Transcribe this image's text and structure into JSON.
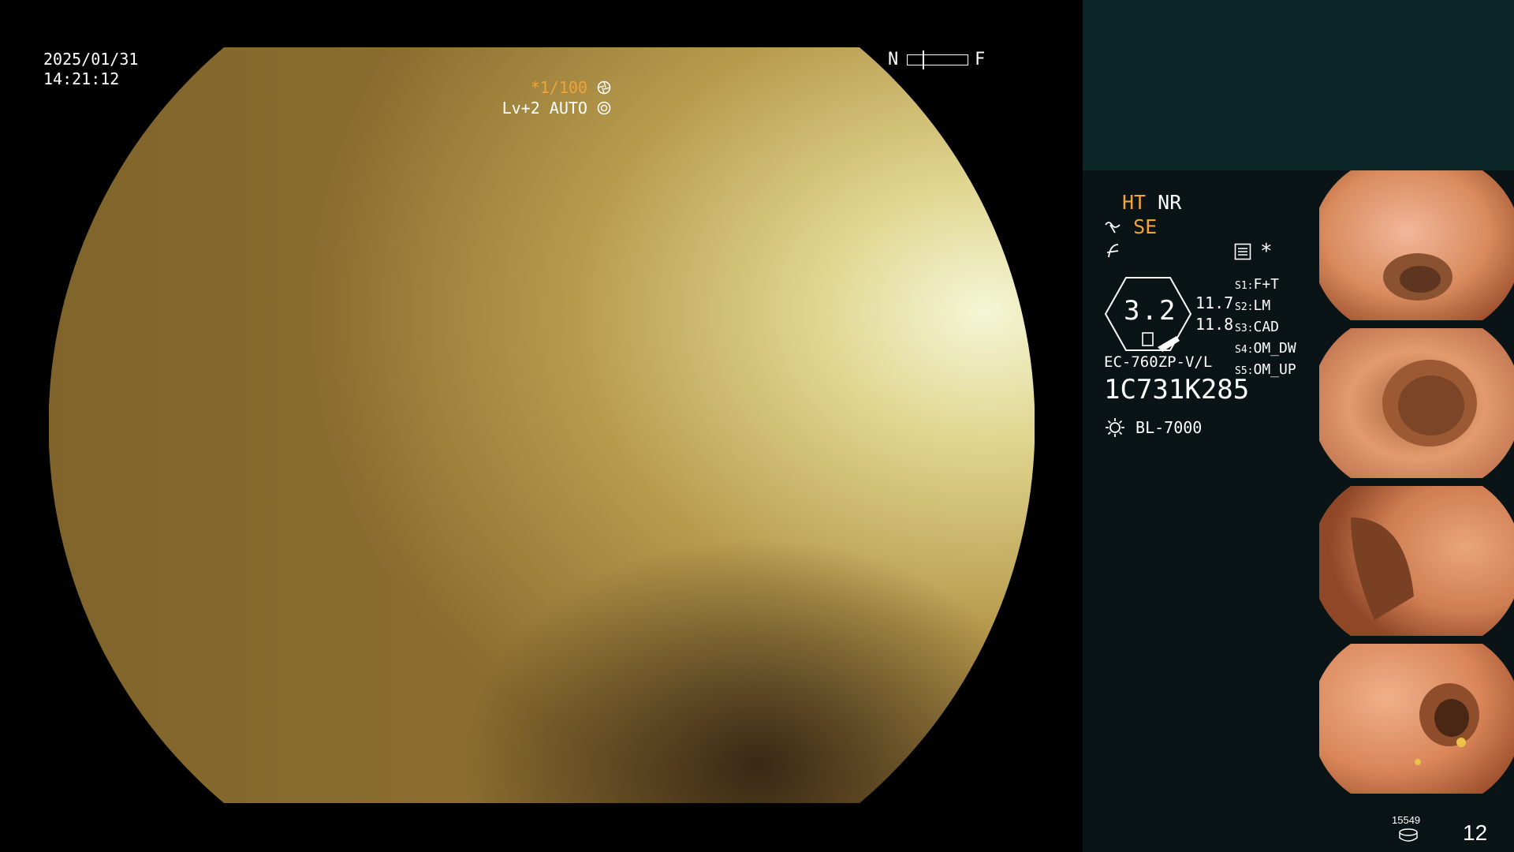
{
  "overlay": {
    "date": "2025/01/31",
    "time": "14:21:12",
    "nf_near": "N",
    "nf_far": "F",
    "shutter": "*1/100",
    "level": "Lv+2 AUTO"
  },
  "side": {
    "mode_ht": "HT",
    "mode_nr": "NR",
    "mode_se": "SE",
    "asterisk": "*",
    "gauge_value": "3.2",
    "gauge_v1": "11.7",
    "gauge_v2": "11.8",
    "scope_model": "EC-760ZP-V/L",
    "serial": "1C731K285",
    "light_source": "BL-7000",
    "s_keys": [
      "S1:",
      "S2:",
      "S3:",
      "S4:",
      "S5:"
    ],
    "s_values": [
      "F+T",
      "LM",
      "CAD",
      "OM_DW",
      "OM_UP"
    ],
    "frame_count": "15549",
    "thumb_count": "12"
  },
  "colors": {
    "accent": "#f2a33a",
    "panel_top": "#0b2627",
    "panel": "#0a1416"
  },
  "icons": {
    "shutter": "aperture-icon",
    "level": "iris-icon",
    "mode": "se-mode-icon",
    "freeze": "freeze-icon",
    "menu": "settings-list-icon",
    "light": "lamp-icon",
    "storage": "disk-icon"
  }
}
